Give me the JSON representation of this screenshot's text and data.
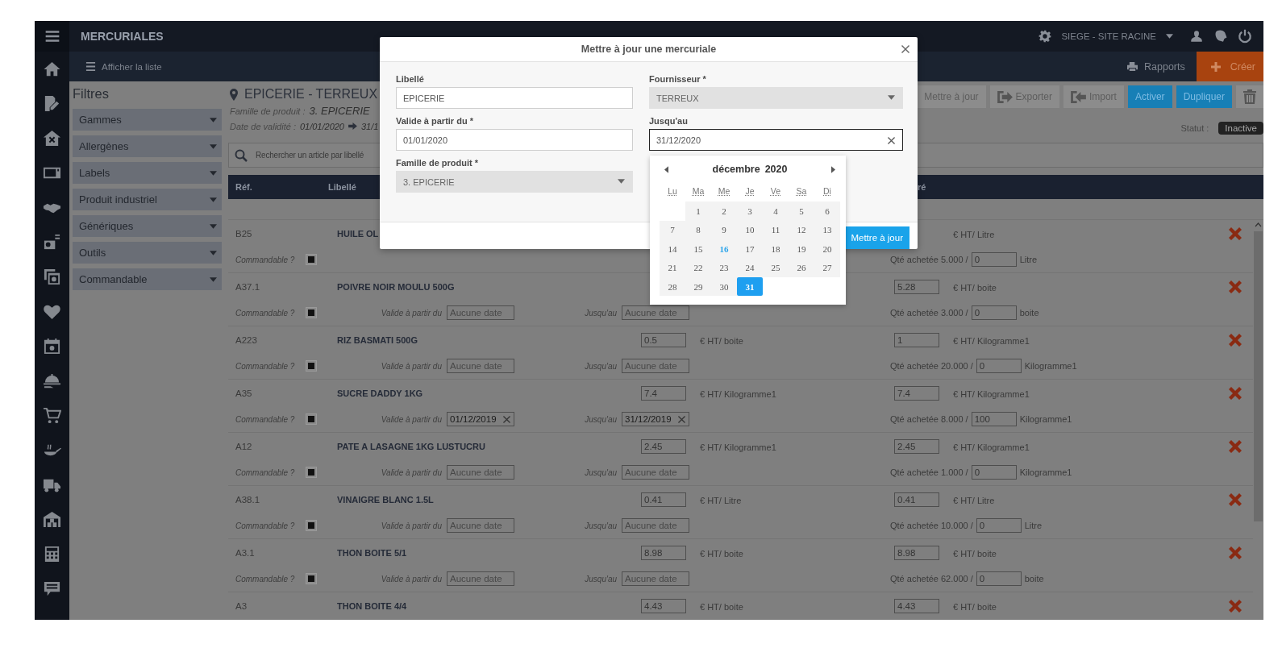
{
  "header": {
    "title": "MERCURIALES",
    "site": "SIEGE - SITE RACINE"
  },
  "subbar": {
    "list_link": "Afficher la liste",
    "reports": "Rapports",
    "create": "Créer"
  },
  "filters": {
    "title": "Filtres",
    "items": [
      "Gammes",
      "Allergènes",
      "Labels",
      "Produit industriel",
      "Génériques",
      "Outils",
      "Commandable"
    ]
  },
  "mercuriale": {
    "title": "EPICERIE - TERREUX",
    "family_label": "Famille de produit :",
    "family": "3. EPICERIE",
    "validity_label": "Date de validité :",
    "valid_from": "01/01/2020",
    "valid_to": "31/1"
  },
  "actions": [
    {
      "kind": "plain",
      "label": "Mettre à jour"
    },
    {
      "kind": "export",
      "label": "Exporter"
    },
    {
      "kind": "import",
      "label": "Import"
    },
    {
      "kind": "primary",
      "label": "Activer"
    },
    {
      "kind": "primary",
      "label": "Dupliquer"
    },
    {
      "kind": "delete"
    }
  ],
  "status": {
    "label": "Statut :",
    "value": "Inactive"
  },
  "search": {
    "placeholder": "Rechercher un article par libellé"
  },
  "table": {
    "columns": [
      "Réf.",
      "Libellé",
      "ré"
    ],
    "rows": [
      {
        "ref": "B25",
        "name": "HUILE OL",
        "unit2": "€ HT/ Litre",
        "line2": {
          "commandable_label": "Commandable ?",
          "commandable": true,
          "qty_label": "Qté achetée 5.000 /",
          "qty": "0",
          "qty_unit": "Litre"
        }
      },
      {
        "ref": "A37.1",
        "name": "POIVRE NOIR MOULU 500G",
        "price2": "5.28",
        "unit2": "€ HT/ boite",
        "line2": {
          "commandable_label": "Commandable ?",
          "commandable": true,
          "from_label": "Valide à partir du",
          "from": {
            "placeholder": "Aucune date"
          },
          "to_label": "Jusqu'au",
          "to": {
            "placeholder": "Aucune date"
          },
          "qty_label": "Qté achetée 3.000 /",
          "qty": "0",
          "qty_unit": "boite"
        }
      },
      {
        "ref": "A223",
        "name": "RIZ BASMATI 500G",
        "price": "0.5",
        "unit": "€ HT/ boite",
        "price2": "1",
        "unit2": "€ HT/ Kilogramme1",
        "line2": {
          "commandable_label": "Commandable ?",
          "commandable": true,
          "from_label": "Valide à partir du",
          "from": {
            "placeholder": "Aucune date"
          },
          "to_label": "Jusqu'au",
          "to": {
            "placeholder": "Aucune date"
          },
          "qty_label": "Qté achetée 20.000 /",
          "qty": "0",
          "qty_unit": "Kilogramme1"
        }
      },
      {
        "ref": "A35",
        "name": "SUCRE DADDY 1KG",
        "price": "7.4",
        "unit": "€ HT/ Kilogramme1",
        "price2": "7.4",
        "unit2": "€ HT/ Kilogramme1",
        "line2": {
          "commandable_label": "Commandable ?",
          "commandable": true,
          "from_label": "Valide à partir du",
          "from": {
            "value": "01/12/2019"
          },
          "to_label": "Jusqu'au",
          "to": {
            "value": "31/12/2019"
          },
          "qty_label": "Qté achetée 8.000 /",
          "qty": "100",
          "qty_unit": "Kilogramme1"
        }
      },
      {
        "ref": "A12",
        "name": "PATE A LASAGNE 1KG LUSTUCRU",
        "price": "2.45",
        "unit": "€ HT/ Kilogramme1",
        "price2": "2.45",
        "unit2": "€ HT/ Kilogramme1",
        "line2": {
          "commandable_label": "Commandable ?",
          "commandable": true,
          "from_label": "Valide à partir du",
          "from": {
            "placeholder": "Aucune date"
          },
          "to_label": "Jusqu'au",
          "to": {
            "placeholder": "Aucune date"
          },
          "qty_label": "Qté achetée 1.000 /",
          "qty": "0",
          "qty_unit": "Kilogramme1"
        }
      },
      {
        "ref": "A38.1",
        "name": "VINAIGRE BLANC 1.5L",
        "price": "0.41",
        "unit": "€ HT/ Litre",
        "price2": "0.41",
        "unit2": "€ HT/ Litre",
        "line2": {
          "commandable_label": "Commandable ?",
          "commandable": true,
          "from_label": "Valide à partir du",
          "from": {
            "placeholder": "Aucune date"
          },
          "to_label": "Jusqu'au",
          "to": {
            "placeholder": "Aucune date"
          },
          "qty_label": "Qté achetée 10.000 /",
          "qty": "0",
          "qty_unit": "Litre"
        }
      },
      {
        "ref": "A3.1",
        "name": "THON BOITE 5/1",
        "price": "8.98",
        "unit": "€ HT/ boite",
        "price2": "8.98",
        "unit2": "€ HT/ boite",
        "line2": {
          "commandable_label": "Commandable ?",
          "commandable": true,
          "from_label": "Valide à partir du",
          "from": {
            "placeholder": "Aucune date"
          },
          "to_label": "Jusqu'au",
          "to": {
            "placeholder": "Aucune date"
          },
          "qty_label": "Qté achetée 62.000 /",
          "qty": "0",
          "qty_unit": "boite"
        }
      },
      {
        "ref": "A3",
        "name": "THON BOITE 4/4",
        "price": "4.43",
        "unit": "€ HT/ boite",
        "price2": "4.43",
        "unit2": "€ HT/ boite"
      }
    ]
  },
  "modal": {
    "title": "Mettre à jour une mercuriale",
    "fields": [
      {
        "label": "Libellé",
        "kind": "text",
        "value": "EPICERIE",
        "focused": false
      },
      {
        "label": "Fournisseur *",
        "kind": "select",
        "value": "TERREUX",
        "focused": false
      },
      {
        "label": "Valide à partir du *",
        "kind": "text",
        "value": "01/01/2020",
        "focused": false
      },
      {
        "label": "Jusqu'au",
        "kind": "date",
        "value": "31/12/2020",
        "focused": true
      },
      {
        "label": "Famille de produit *",
        "kind": "select",
        "value": "3. EPICERIE",
        "focused": false
      }
    ],
    "submit": "Mettre à jour"
  },
  "datepicker": {
    "month": "décembre",
    "year": "2020",
    "weekdays": [
      "Lu",
      "Ma",
      "Me",
      "Je",
      "Ve",
      "Sa",
      "Di"
    ],
    "days": [
      {
        "label": "1",
        "selected": false,
        "today": false
      },
      {
        "label": "2",
        "selected": false,
        "today": false
      },
      {
        "label": "3",
        "selected": false,
        "today": false
      },
      {
        "label": "4",
        "selected": false,
        "today": false
      },
      {
        "label": "5",
        "selected": false,
        "today": false
      },
      {
        "label": "6",
        "selected": false,
        "today": false
      },
      {
        "label": "7",
        "selected": false,
        "today": false
      },
      {
        "label": "8",
        "selected": false,
        "today": false
      },
      {
        "label": "9",
        "selected": false,
        "today": false
      },
      {
        "label": "10",
        "selected": false,
        "today": false
      },
      {
        "label": "11",
        "selected": false,
        "today": false
      },
      {
        "label": "12",
        "selected": false,
        "today": false
      },
      {
        "label": "13",
        "selected": false,
        "today": false
      },
      {
        "label": "14",
        "selected": false,
        "today": false
      },
      {
        "label": "15",
        "selected": false,
        "today": false
      },
      {
        "label": "16",
        "selected": false,
        "today": true
      },
      {
        "label": "17",
        "selected": false,
        "today": false
      },
      {
        "label": "18",
        "selected": false,
        "today": false
      },
      {
        "label": "19",
        "selected": false,
        "today": false
      },
      {
        "label": "20",
        "selected": false,
        "today": false
      },
      {
        "label": "21",
        "selected": false,
        "today": false
      },
      {
        "label": "22",
        "selected": false,
        "today": false
      },
      {
        "label": "23",
        "selected": false,
        "today": false
      },
      {
        "label": "24",
        "selected": false,
        "today": false
      },
      {
        "label": "25",
        "selected": false,
        "today": false
      },
      {
        "label": "26",
        "selected": false,
        "today": false
      },
      {
        "label": "27",
        "selected": false,
        "today": false
      },
      {
        "label": "28",
        "selected": false,
        "today": false
      },
      {
        "label": "29",
        "selected": false,
        "today": false
      },
      {
        "label": "30",
        "selected": false,
        "today": false
      },
      {
        "label": "31",
        "selected": true,
        "today": false
      }
    ]
  }
}
